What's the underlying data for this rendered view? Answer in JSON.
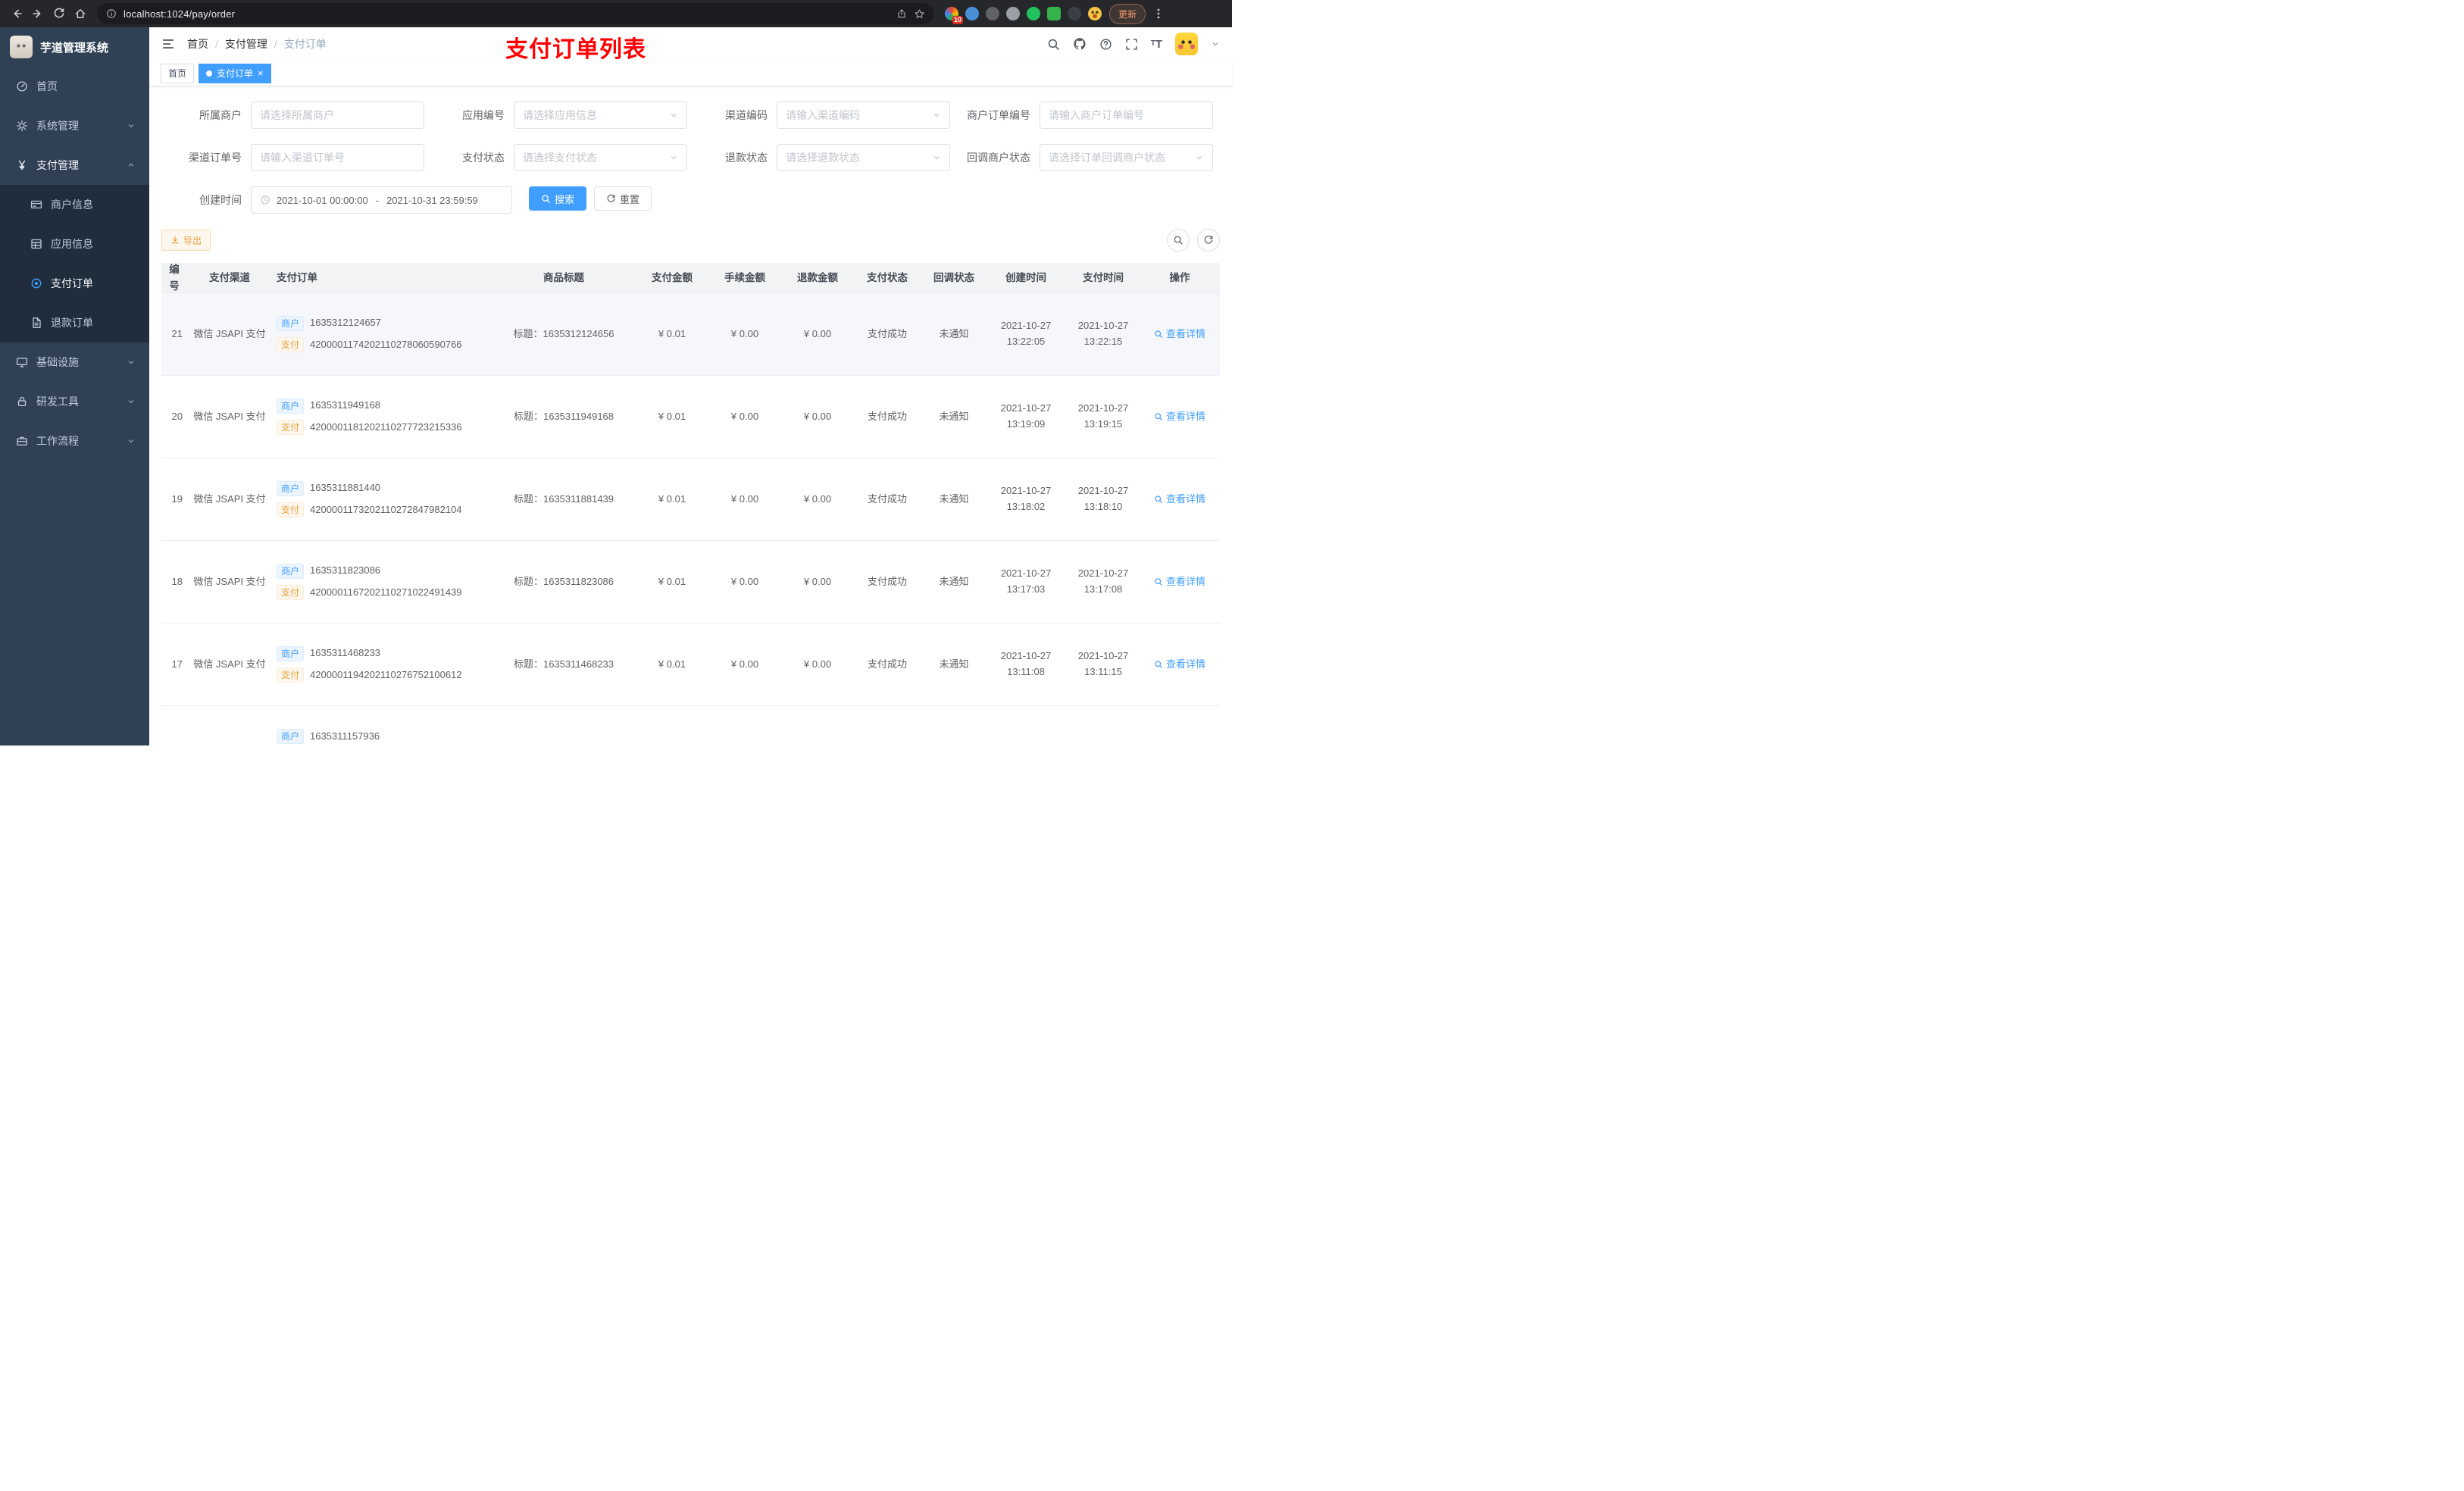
{
  "browser": {
    "url": "localhost:1024/pay/order",
    "update_label": "更新",
    "extension_badge": "10"
  },
  "sidebar": {
    "logo_title": "芋道管理系统",
    "items": {
      "home": "首页",
      "system": "系统管理",
      "payment": "支付管理",
      "infra": "基础设施",
      "devtools": "研发工具",
      "workflow": "工作流程"
    },
    "payment_children": {
      "merchant": "商户信息",
      "app": "应用信息",
      "pay_order": "支付订单",
      "refund_order": "退款订单"
    }
  },
  "header": {
    "breadcrumb": {
      "home": "首页",
      "section": "支付管理",
      "current": "支付订单"
    },
    "separator": "/",
    "page_title": "支付订单列表"
  },
  "tags": {
    "home": "首页",
    "current": "支付订单",
    "close": "×"
  },
  "filters": {
    "merchant": {
      "label": "所属商户",
      "placeholder": "请选择所属商户"
    },
    "app_no": {
      "label": "应用编号",
      "placeholder": "请选择应用信息"
    },
    "channel_code": {
      "label": "渠道编码",
      "placeholder": "请输入渠道编码"
    },
    "merchant_order_no": {
      "label": "商户订单编号",
      "placeholder": "请输入商户订单编号"
    },
    "channel_order_no": {
      "label": "渠道订单号",
      "placeholder": "请输入渠道订单号"
    },
    "pay_status": {
      "label": "支付状态",
      "placeholder": "请选择支付状态"
    },
    "refund_status": {
      "label": "退款状态",
      "placeholder": "请选择退款状态"
    },
    "callback_status": {
      "label": "回调商户状态",
      "placeholder": "请选择订单回调商户状态"
    },
    "create_time": {
      "label": "创建时间",
      "start": "2021-10-01 00:00:00",
      "separator": "-",
      "end": "2021-10-31 23:59:59"
    },
    "search_label": "搜索",
    "reset_label": "重置"
  },
  "toolbar": {
    "export_label": "导出"
  },
  "table": {
    "columns": [
      "编号",
      "支付渠道",
      "支付订单",
      "商品标题",
      "支付金额",
      "手续金额",
      "退款金额",
      "支付状态",
      "回调状态",
      "创建时间",
      "支付时间",
      "操作"
    ],
    "badges": {
      "merchant": "商户",
      "pay": "支付"
    },
    "action_label": "查看详情",
    "rows": [
      {
        "id": "21",
        "channel": "微信 JSAPI 支付",
        "merchant_no": "1635312124657",
        "pay_no": "4200001174202110278060590766",
        "title": "标题：1635312124656",
        "amount": "¥ 0.01",
        "fee": "¥ 0.00",
        "refund": "¥ 0.00",
        "status": "支付成功",
        "notify": "未通知",
        "create_time": "2021-10-27 13:22:05",
        "pay_time": "2021-10-27 13:22:15"
      },
      {
        "id": "20",
        "channel": "微信 JSAPI 支付",
        "merchant_no": "1635311949168",
        "pay_no": "4200001181202110277723215336",
        "title": "标题：1635311949168",
        "amount": "¥ 0.01",
        "fee": "¥ 0.00",
        "refund": "¥ 0.00",
        "status": "支付成功",
        "notify": "未通知",
        "create_time": "2021-10-27 13:19:09",
        "pay_time": "2021-10-27 13:19:15"
      },
      {
        "id": "19",
        "channel": "微信 JSAPI 支付",
        "merchant_no": "1635311881440",
        "pay_no": "4200001173202110272847982104",
        "title": "标题：1635311881439",
        "amount": "¥ 0.01",
        "fee": "¥ 0.00",
        "refund": "¥ 0.00",
        "status": "支付成功",
        "notify": "未通知",
        "create_time": "2021-10-27 13:18:02",
        "pay_time": "2021-10-27 13:18:10"
      },
      {
        "id": "18",
        "channel": "微信 JSAPI 支付",
        "merchant_no": "1635311823086",
        "pay_no": "4200001167202110271022491439",
        "title": "标题：1635311823086",
        "amount": "¥ 0.01",
        "fee": "¥ 0.00",
        "refund": "¥ 0.00",
        "status": "支付成功",
        "notify": "未通知",
        "create_time": "2021-10-27 13:17:03",
        "pay_time": "2021-10-27 13:17:08"
      },
      {
        "id": "17",
        "channel": "微信 JSAPI 支付",
        "merchant_no": "1635311468233",
        "pay_no": "4200001194202110276752100612",
        "title": "标题：1635311468233",
        "amount": "¥ 0.01",
        "fee": "¥ 0.00",
        "refund": "¥ 0.00",
        "status": "支付成功",
        "notify": "未通知",
        "create_time": "2021-10-27 13:11:08",
        "pay_time": "2021-10-27 13:11:15"
      }
    ],
    "partial_row": {
      "merchant_no": "1635311157936",
      "pay_no": ""
    }
  }
}
